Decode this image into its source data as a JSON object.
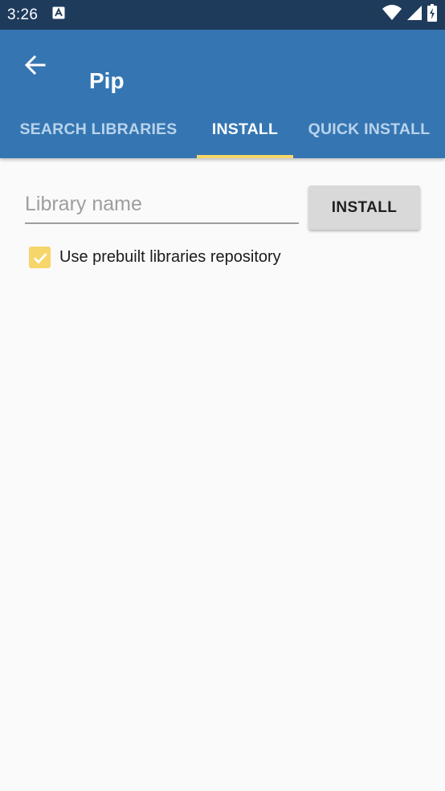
{
  "status_bar": {
    "time": "3:26"
  },
  "app_bar": {
    "title": "Pip"
  },
  "tabs": [
    {
      "label": "SEARCH LIBRARIES",
      "active": false
    },
    {
      "label": "INSTALL",
      "active": true
    },
    {
      "label": "QUICK INSTALL",
      "active": false
    }
  ],
  "install_form": {
    "library_input": {
      "value": "",
      "placeholder": "Library name"
    },
    "install_button_label": "INSTALL",
    "prebuilt_checkbox": {
      "label": "Use prebuilt libraries repository",
      "checked": true
    }
  },
  "colors": {
    "status_bar": "#1f3b5c",
    "app_bar": "#3576b2",
    "accent": "#f6d66a",
    "background": "#fafafa"
  },
  "icons": {
    "back": "arrow-back-icon",
    "notification": "font-a-icon",
    "wifi": "wifi-icon",
    "signal": "signal-icon",
    "battery": "battery-charging-icon"
  }
}
